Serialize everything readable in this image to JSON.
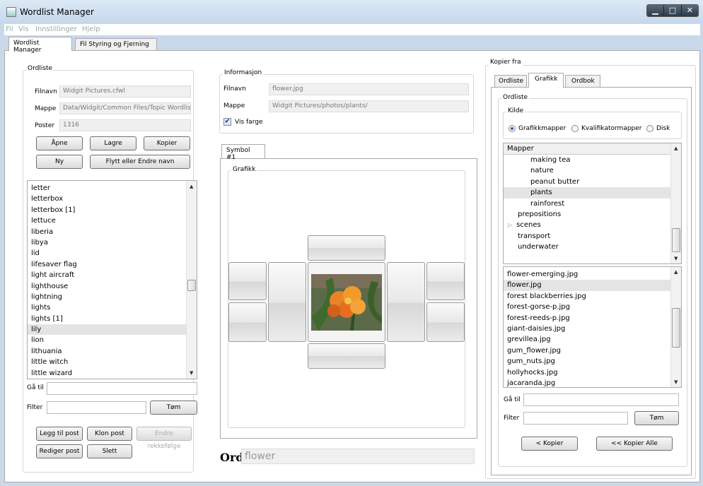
{
  "window": {
    "title": "Wordlist Manager",
    "min": "▁",
    "max": "□",
    "close": "✕"
  },
  "menu": [
    "Fil",
    "Vis",
    "Innstillinger",
    "Hjelp"
  ],
  "tabs": [
    "Wordlist Manager",
    "Fil Styring og Fjerning"
  ],
  "ordliste": {
    "group": "Ordliste",
    "filnavn_label": "Filnavn",
    "filnavn": "Widgit Pictures.cfwl",
    "mappe_label": "Mappe",
    "mappe": "Data/Widgit/Common Files/Topic Wordlists/",
    "poster_label": "Poster",
    "poster": "1316",
    "btn_open": "Åpne",
    "btn_save": "Lagre",
    "btn_copy": "Kopier",
    "btn_new": "Ny",
    "btn_move": "Flytt eller Endre navn",
    "words": [
      "letter",
      "letterbox",
      "letterbox [1]",
      "lettuce",
      "liberia",
      "libya",
      "lid",
      "lifesaver flag",
      "light aircraft",
      "lighthouse",
      "lightning",
      "lights",
      "lights [1]",
      "lily",
      "lion",
      "lithuania",
      "little witch",
      "little wizard"
    ],
    "selected": "lily",
    "goto_label": "Gå til",
    "filter_label": "Filter",
    "btn_clear": "Tøm",
    "btn_add": "Legg til post",
    "btn_clone": "Klon post",
    "btn_reorder": "Endre rekkefølge",
    "btn_edit": "Rediger post",
    "btn_delete": "Slett"
  },
  "info": {
    "group": "Informasjon",
    "filnavn_label": "Filnavn",
    "filnavn": "flower.jpg",
    "mappe_label": "Mappe",
    "mappe": "Widgit Pictures/photos/plants/",
    "vis_farge": "Vis farge",
    "vis_farge_checked": true,
    "symbol_tab": "Symbol #1",
    "grafikk": "Grafikk",
    "ord_label": "Ord",
    "ord_value": "flower"
  },
  "kopier": {
    "group": "Kopier fra",
    "tabs": [
      "Ordliste",
      "Grafikk",
      "Ordbok"
    ],
    "inner_group": "Ordliste",
    "kilde": "Kilde",
    "radios": [
      "Grafikkmapper",
      "Kvalifikatormapper",
      "Disk"
    ],
    "radio_selected": "Grafikkmapper",
    "mapper_header": "Mapper",
    "folders": [
      {
        "label": "making tea",
        "indent": 2
      },
      {
        "label": "nature",
        "indent": 2
      },
      {
        "label": "peanut butter",
        "indent": 2
      },
      {
        "label": "plants",
        "indent": 2,
        "selected": true
      },
      {
        "label": "rainforest",
        "indent": 2
      },
      {
        "label": "prepositions",
        "indent": 1
      },
      {
        "label": "scenes",
        "indent": 1,
        "expander": "▷"
      },
      {
        "label": "transport",
        "indent": 1
      },
      {
        "label": "underwater",
        "indent": 1
      }
    ],
    "files": [
      "flower-emerging.jpg",
      "flower.jpg",
      "forest blackberries.jpg",
      "forest-gorse-p.jpg",
      "forest-reeds-p.jpg",
      "giant-daisies.jpg",
      "grevillea.jpg",
      "gum_flower.jpg",
      "gum_nuts.jpg",
      "hollyhocks.jpg",
      "jacaranda.jpg"
    ],
    "selected_file": "flower.jpg",
    "goto_label": "Gå til",
    "filter_label": "Filter",
    "btn_clear": "Tøm",
    "btn_copy": "< Kopier",
    "btn_copy_all": "<< Kopier Alle"
  },
  "colors": {
    "accent": "#2b5ea8",
    "selection": "#e4e4e4",
    "frame": "#c9d9ea"
  }
}
